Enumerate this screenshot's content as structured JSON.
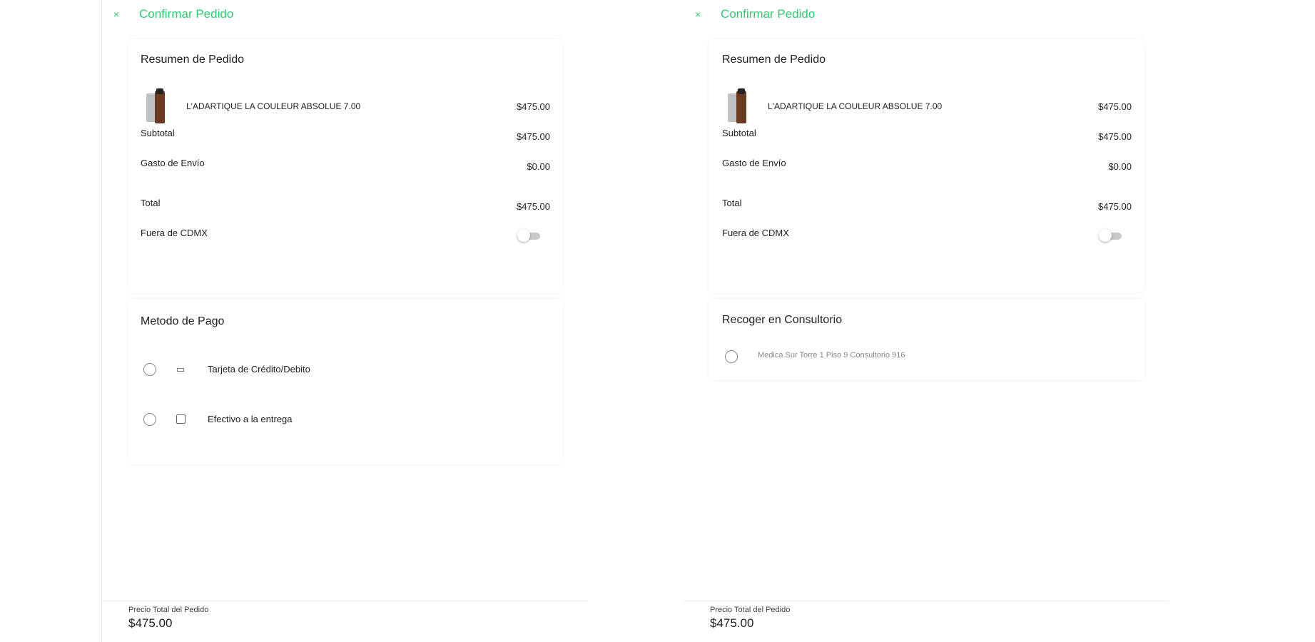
{
  "panels": {
    "left": {
      "title": "Confirmar Pedido",
      "summary": {
        "title": "Resumen de Pedido",
        "product": {
          "name": "L'ADARTIQUE LA COULEUR ABSOLUE 7.00",
          "price": "$475.00"
        },
        "subtotal": {
          "label": "Subtotal",
          "value": "$475.00"
        },
        "shipping": {
          "label": "Gasto de Envío",
          "value": "$0.00"
        },
        "total": {
          "label": "Total",
          "value": "$475.00"
        },
        "outside_cdmx": {
          "label": "Fuera de CDMX",
          "toggle": "off"
        }
      },
      "payment": {
        "title": "Metodo de Pago",
        "options": [
          {
            "icon": "credit-card-icon",
            "glyph": "▭",
            "label": "Tarjeta de Crédito/Debito"
          },
          {
            "icon": "cash-icon",
            "label": "Efectivo a la entrega"
          }
        ]
      },
      "footer": {
        "label": "Precio Total del Pedido",
        "total": "$475.00"
      }
    },
    "right": {
      "title": "Confirmar Pedido",
      "summary": {
        "title": "Resumen de Pedido",
        "product": {
          "name": "L'ADARTIQUE LA COULEUR ABSOLUE 7.00",
          "price": "$475.00"
        },
        "subtotal": {
          "label": "Subtotal",
          "value": "$475.00"
        },
        "shipping": {
          "label": "Gasto de Envío",
          "value": "$0.00"
        },
        "total": {
          "label": "Total",
          "value": "$475.00"
        },
        "outside_cdmx": {
          "label": "Fuera de CDMX",
          "toggle": "off"
        }
      },
      "pickup": {
        "title": "Recoger en Consultorio",
        "option": "Medica Sur Torre 1 Piso 9 Consultorio 916"
      },
      "footer": {
        "label": "Precio Total del Pedido",
        "total": "$475.00"
      }
    }
  },
  "colors": {
    "accent": "#2ecc71",
    "product_bottle": "#6b3a1f",
    "toggle_track": "#c9c9c9"
  },
  "icons": {
    "back": "×"
  }
}
